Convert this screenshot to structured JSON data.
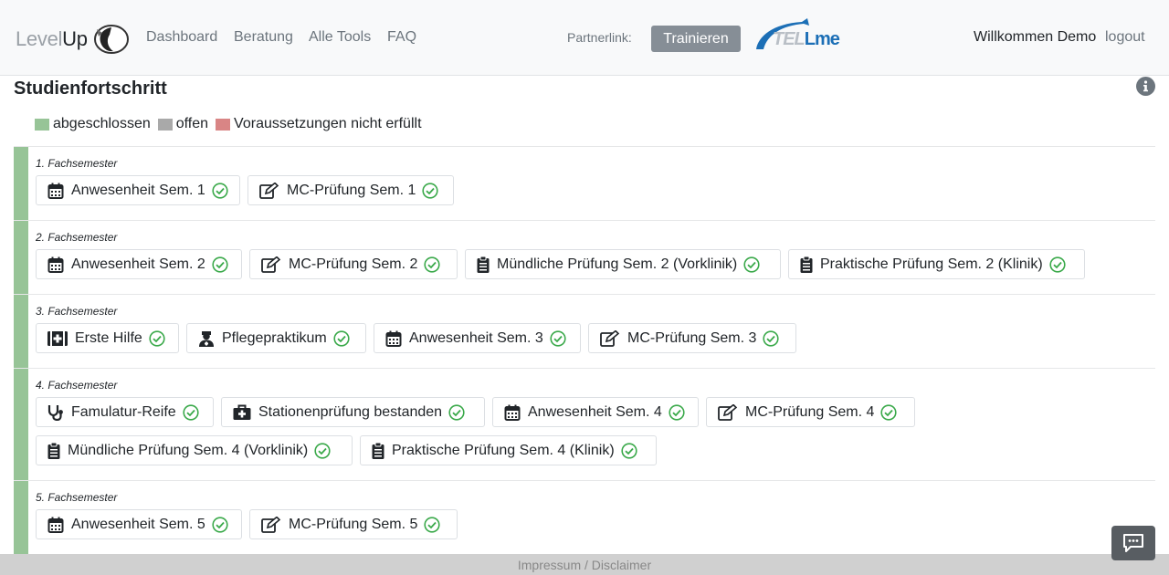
{
  "header": {
    "logo_light": "Level",
    "logo_dark": "Up",
    "nav": [
      "Dashboard",
      "Beratung",
      "Alle Tools",
      "FAQ"
    ],
    "partner_label": "Partnerlink:",
    "trainieren_button": "Trainieren",
    "partner_logo_a": "TEL",
    "partner_logo_b": "Lme",
    "welcome": "Willkommen Demo",
    "logout": "logout"
  },
  "page": {
    "title": "Studienfortschritt",
    "legend": [
      {
        "label": "abgeschlossen",
        "color": "#97c497"
      },
      {
        "label": "offen",
        "color": "#a9a9a9"
      },
      {
        "label": "Voraussetzungen nicht erfüllt",
        "color": "#d98585"
      }
    ]
  },
  "semesters": [
    {
      "label": "1. Fachsemester",
      "color": "#97c497",
      "items": [
        {
          "icon": "calendar-icon",
          "label": "Anwesenheit Sem. 1",
          "status": "done"
        },
        {
          "icon": "edit-icon",
          "label": "MC-Prüfung Sem. 1",
          "status": "done"
        }
      ]
    },
    {
      "label": "2. Fachsemester",
      "color": "#97c497",
      "items": [
        {
          "icon": "calendar-icon",
          "label": "Anwesenheit Sem. 2",
          "status": "done"
        },
        {
          "icon": "edit-icon",
          "label": "MC-Prüfung Sem. 2",
          "status": "done"
        },
        {
          "icon": "clipboard-icon",
          "label": "Mündliche Prüfung Sem. 2 (Vorklinik)",
          "status": "done"
        },
        {
          "icon": "clipboard-icon",
          "label": "Praktische Prüfung Sem. 2 (Klinik)",
          "status": "done"
        }
      ]
    },
    {
      "label": "3. Fachsemester",
      "color": "#97c497",
      "items": [
        {
          "icon": "first-aid-icon",
          "label": "Erste Hilfe",
          "status": "done"
        },
        {
          "icon": "nurse-icon",
          "label": "Pflegepraktikum",
          "status": "done"
        },
        {
          "icon": "calendar-icon",
          "label": "Anwesenheit Sem. 3",
          "status": "done"
        },
        {
          "icon": "edit-icon",
          "label": "MC-Prüfung Sem. 3",
          "status": "done"
        }
      ]
    },
    {
      "label": "4. Fachsemester",
      "color": "#97c497",
      "items": [
        {
          "icon": "stethoscope-icon",
          "label": "Famulatur-Reife",
          "status": "done"
        },
        {
          "icon": "medkit-icon",
          "label": "Stationenprüfung bestanden",
          "status": "done"
        },
        {
          "icon": "calendar-icon",
          "label": "Anwesenheit Sem. 4",
          "status": "done"
        },
        {
          "icon": "edit-icon",
          "label": "MC-Prüfung Sem. 4",
          "status": "done"
        },
        {
          "icon": "clipboard-icon",
          "label": "Mündliche Prüfung Sem. 4 (Vorklinik)",
          "status": "done"
        },
        {
          "icon": "clipboard-icon",
          "label": "Praktische Prüfung Sem. 4 (Klinik)",
          "status": "done"
        }
      ]
    },
    {
      "label": "5. Fachsemester",
      "color": "#97c497",
      "items": [
        {
          "icon": "calendar-icon",
          "label": "Anwesenheit Sem. 5",
          "status": "done"
        },
        {
          "icon": "edit-icon",
          "label": "MC-Prüfung Sem. 5",
          "status": "done"
        }
      ]
    }
  ],
  "footer": {
    "text": "Impressum / Disclaimer"
  }
}
